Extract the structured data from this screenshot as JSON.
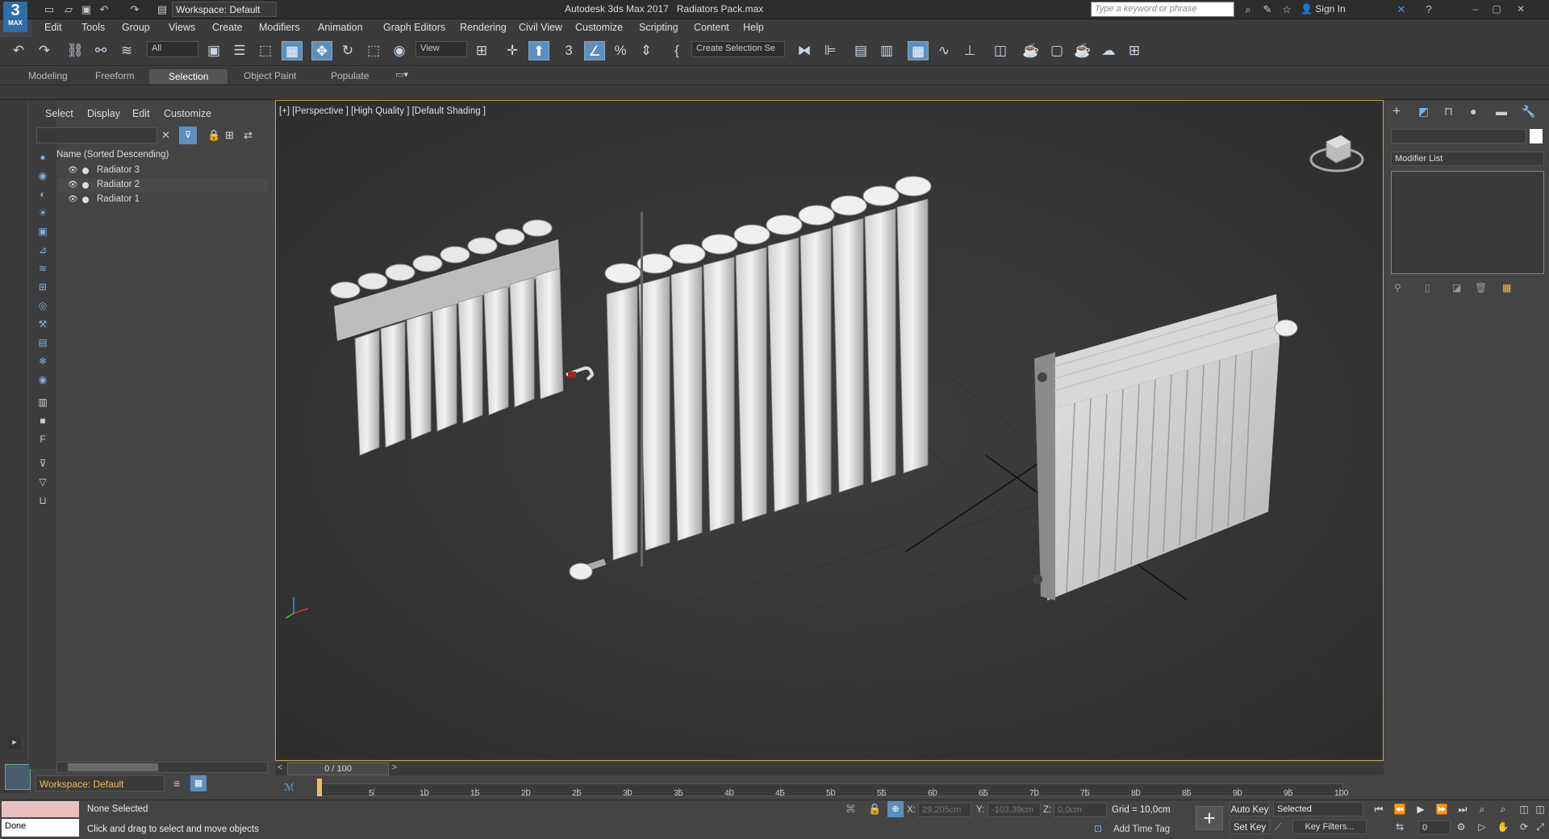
{
  "app": {
    "logo_text": "3",
    "logo_sub": "MAX",
    "title": "Autodesk 3ds Max 2017",
    "file_name": "Radiators Pack.max",
    "workspace": "Workspace: Default",
    "search_placeholder": "Type a keyword or phrase",
    "sign_in": "Sign In"
  },
  "menu": [
    "Edit",
    "Tools",
    "Group",
    "Views",
    "Create",
    "Modifiers",
    "Animation",
    "Graph Editors",
    "Rendering",
    "Civil View",
    "Customize",
    "Scripting",
    "Content",
    "Help"
  ],
  "toolbar": {
    "filter_value": "All",
    "coord_value": "View",
    "selection_set": "Create Selection Se"
  },
  "ribbon_tabs": [
    "Modeling",
    "Freeform",
    "Selection",
    "Object Paint",
    "Populate"
  ],
  "scene_explorer": {
    "tabs": [
      "Select",
      "Display",
      "Edit",
      "Customize"
    ],
    "header": "Name (Sorted Descending)",
    "items": [
      "Radiator 3",
      "Radiator 2",
      "Radiator 1"
    ]
  },
  "viewport": {
    "label": "[+] [Perspective ] [High Quality ] [Default Shading ]"
  },
  "right_panel": {
    "modifier_list": "Modifier List"
  },
  "timeline": {
    "frame_display": "0 / 100",
    "ticks": [
      "5",
      "10",
      "15",
      "20",
      "25",
      "30",
      "35",
      "40",
      "45",
      "50",
      "55",
      "60",
      "65",
      "70",
      "75",
      "80",
      "85",
      "90",
      "95",
      "100"
    ]
  },
  "status": {
    "done": "Done",
    "selection": "None Selected",
    "prompt": "Click and drag to select and move objects",
    "x_label": "X:",
    "x_value": "29,205cm",
    "y_label": "Y:",
    "y_value": "-103,39cm",
    "z_label": "Z:",
    "z_value": "0,0cm",
    "grid": "Grid = 10,0cm",
    "add_time_tag": "Add Time Tag",
    "auto_key": "Auto Key",
    "set_key": "Set Key",
    "selected": "Selected",
    "key_filters": "Key Filters...",
    "frame": "0"
  },
  "colors": {
    "viewport_border": "#c6a94f",
    "active_button": "#5c8fc0",
    "workspace_text": "#e8c060"
  }
}
